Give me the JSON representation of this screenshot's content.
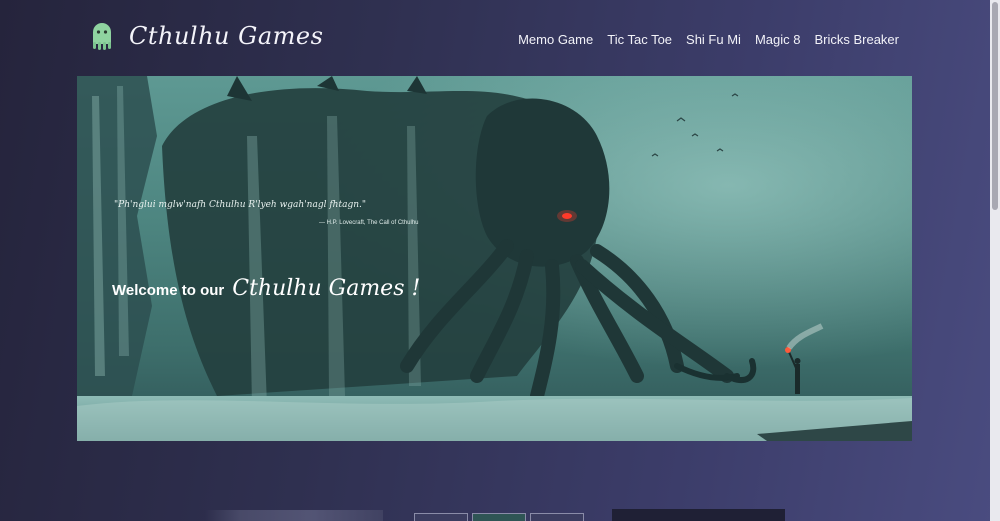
{
  "brand": {
    "name": "Cthulhu Games",
    "icon": "cthulhu-logo-icon"
  },
  "nav": {
    "items": [
      {
        "label": "Memo Game"
      },
      {
        "label": "Tic Tac Toe"
      },
      {
        "label": "Shi Fu Mi"
      },
      {
        "label": "Magic 8"
      },
      {
        "label": "Bricks Breaker"
      }
    ]
  },
  "hero": {
    "quote": "\"Ph'nglui mglw'nafh Cthulhu R'lyeh wgah'nagl fhtagn.\"",
    "attribution": "— H.P. Lovecraft, The Call of Cthulhu",
    "welcome": "Welcome to our",
    "welcome_brand": "Cthulhu Games !"
  },
  "colors": {
    "background_start": "#25243c",
    "background_end": "#4a4c80",
    "hero_teal": "#4d8580",
    "eye_red": "#ff3a2a"
  }
}
